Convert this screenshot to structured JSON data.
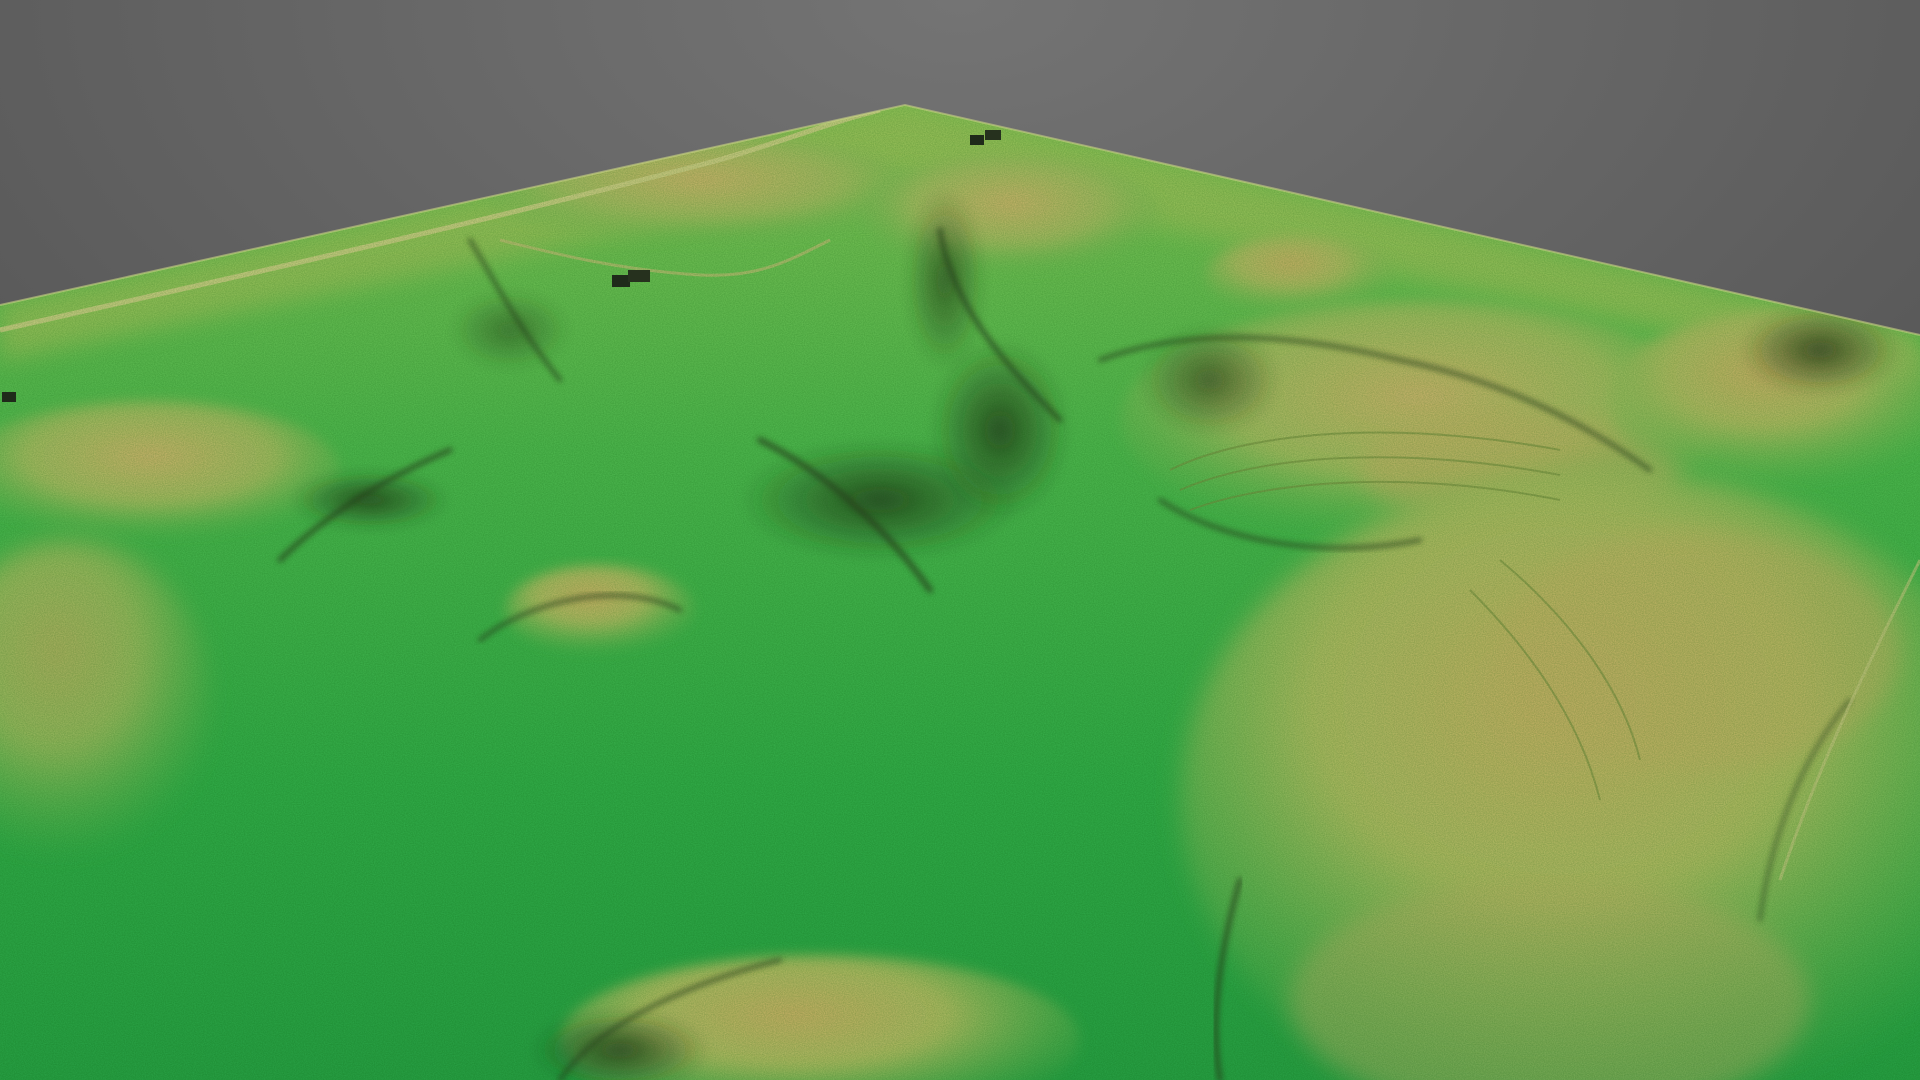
{
  "scene": {
    "kind": "3d-terrain-elevation-model",
    "background_color": "#5e5e5e",
    "colormap": {
      "low": "#2fae4a",
      "mid": "#86c25a",
      "high": "#c9b86a",
      "peak": "#c8a05a",
      "shadow": "#2d3a22"
    },
    "features": [
      "terrain-surface",
      "ridge",
      "valley",
      "hill",
      "road",
      "structure"
    ]
  }
}
